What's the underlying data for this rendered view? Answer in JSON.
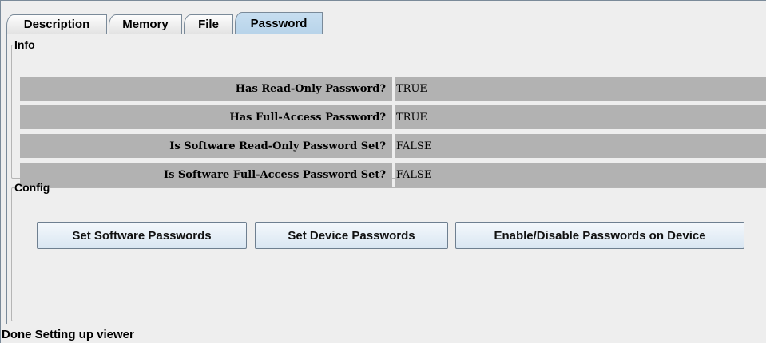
{
  "tabs": [
    "Description",
    "Memory",
    "File",
    "Password"
  ],
  "info": {
    "title": "Info",
    "rows": [
      {
        "label": "Has Read-Only Password?",
        "value": "TRUE"
      },
      {
        "label": "Has Full-Access Password?",
        "value": "TRUE"
      },
      {
        "label": "Is Software Read-Only Password Set?",
        "value": "FALSE"
      },
      {
        "label": "Is Software Full-Access Password Set?",
        "value": "FALSE"
      }
    ]
  },
  "config": {
    "title": "Config",
    "buttons": [
      "Set Software Passwords",
      "Set Device Passwords",
      "Enable/Disable Passwords on Device"
    ]
  },
  "status": "Done Setting up viewer",
  "colors": {
    "active_tab": "#b8d4ea",
    "row_bg": "#b2b2b2"
  }
}
